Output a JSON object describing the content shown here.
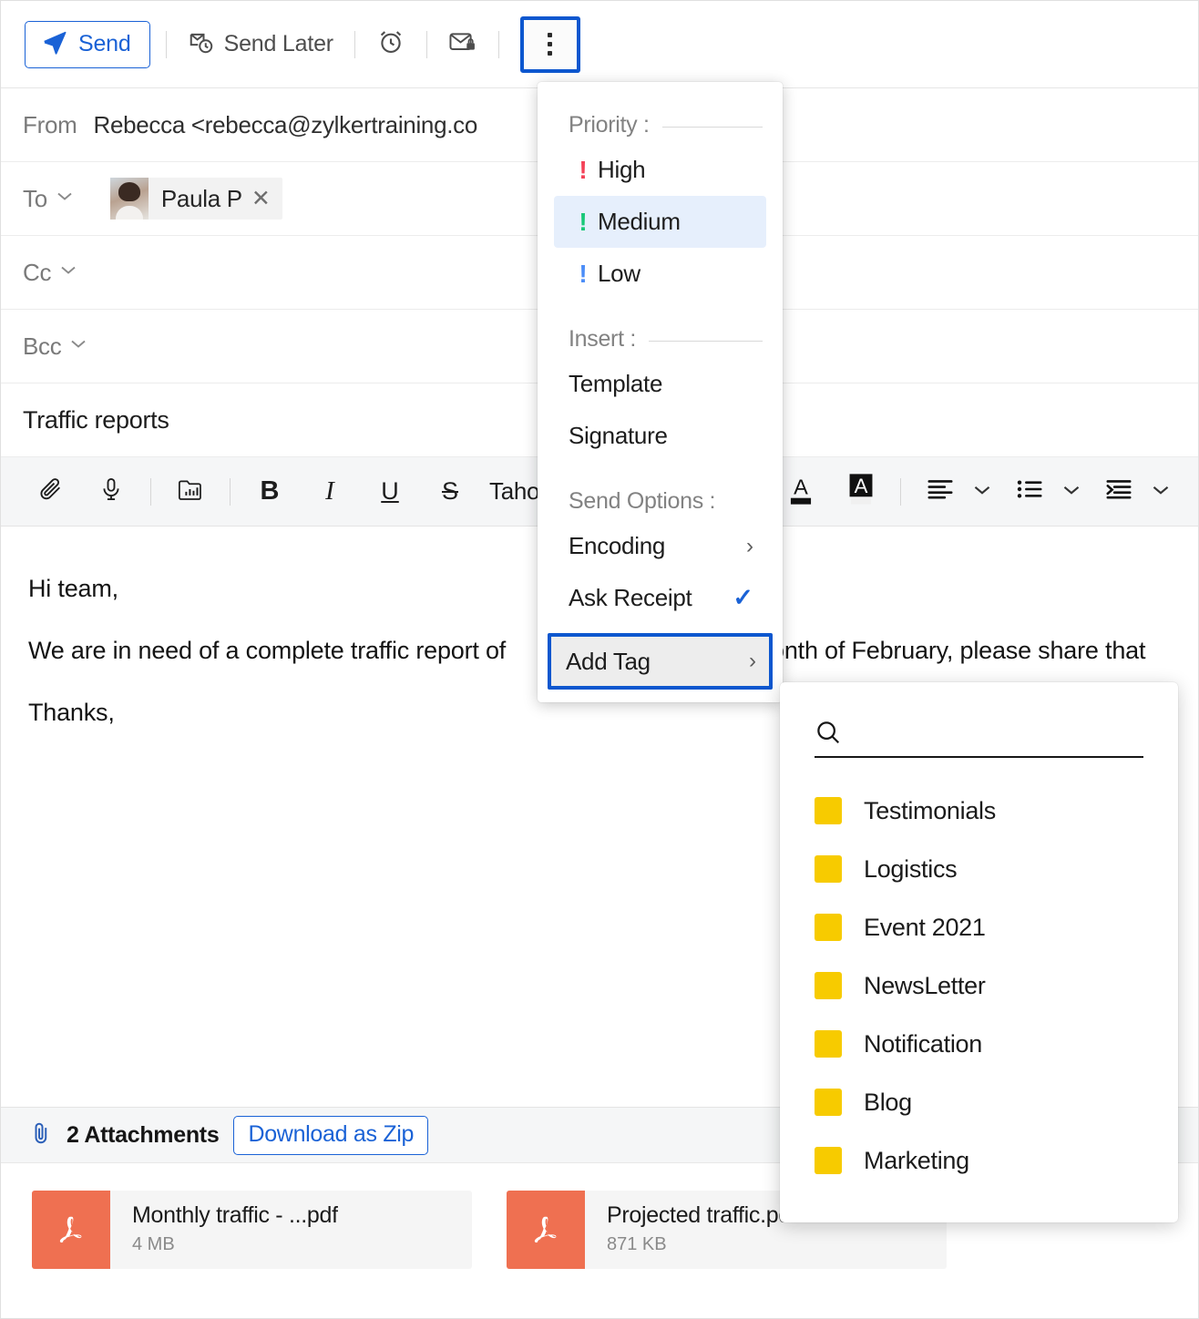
{
  "toolbar": {
    "send_label": "Send",
    "send_later_label": "Send Later",
    "reminder_icon": "alarm-clock-icon",
    "encrypt_icon": "secure-mail-icon",
    "more_icon": "kebab-menu-icon"
  },
  "compose": {
    "from_label": "From",
    "from_value": "Rebecca <rebecca@zylkertraining.co",
    "to_label": "To",
    "to_recipient": "Paula P",
    "cc_label": "Cc",
    "bcc_label": "Bcc",
    "subject": "Traffic reports"
  },
  "format_toolbar": {
    "attach_icon": "paperclip-icon",
    "mic_icon": "microphone-icon",
    "image_icon": "insert-image-icon",
    "bold": "B",
    "italic": "I",
    "underline": "U",
    "strikethrough": "S",
    "font_name": "Tahoma",
    "text_color_icon": "text-color-icon",
    "highlight_icon": "highlight-color-icon",
    "align_icon": "align-left-icon",
    "list_icon": "bullet-list-icon",
    "indent_icon": "indent-icon"
  },
  "body": {
    "line1": "Hi team,",
    "line2_left": "We are in need of a complete traffic report of",
    "line2_right": "month of February, please share that",
    "line3": "Thanks,"
  },
  "menu": {
    "priority_section": "Priority :",
    "priority_items": [
      {
        "label": "High",
        "color": "#f44258",
        "selected": false
      },
      {
        "label": "Medium",
        "color": "#18c878",
        "selected": true
      },
      {
        "label": "Low",
        "color": "#4b8df8",
        "selected": false
      }
    ],
    "insert_section": "Insert :",
    "insert_items": [
      {
        "label": "Template"
      },
      {
        "label": "Signature"
      }
    ],
    "send_options_section": "Send Options :",
    "encoding_label": "Encoding",
    "ask_receipt_label": "Ask Receipt",
    "ask_receipt_checked": "✓",
    "add_tag_label": "Add Tag",
    "submenu_arrow": "›"
  },
  "tag_menu": {
    "search_placeholder": "",
    "search_value": "",
    "search_icon": "search-icon",
    "tags": [
      {
        "label": "Testimonials",
        "color": "#f7cb00"
      },
      {
        "label": "Logistics",
        "color": "#f7cb00"
      },
      {
        "label": "Event 2021",
        "color": "#f7cb00"
      },
      {
        "label": "NewsLetter",
        "color": "#f7cb00"
      },
      {
        "label": "Notification",
        "color": "#f7cb00"
      },
      {
        "label": "Blog",
        "color": "#f7cb00"
      },
      {
        "label": "Marketing",
        "color": "#f7cb00"
      }
    ]
  },
  "attachments": {
    "count_label": "2 Attachments",
    "zip_label": "Download as Zip",
    "items": [
      {
        "name": "Monthly traffic - ...pdf",
        "size": "4 MB"
      },
      {
        "name": "Projected traffic.pdf",
        "size": "871 KB"
      }
    ]
  },
  "colors": {
    "accent_blue": "#1a62d6",
    "highlight_box": "#0d57cf",
    "selected_row": "#e6effc",
    "tag_yellow": "#f7cb00",
    "pdf_orange": "#ef7051"
  }
}
